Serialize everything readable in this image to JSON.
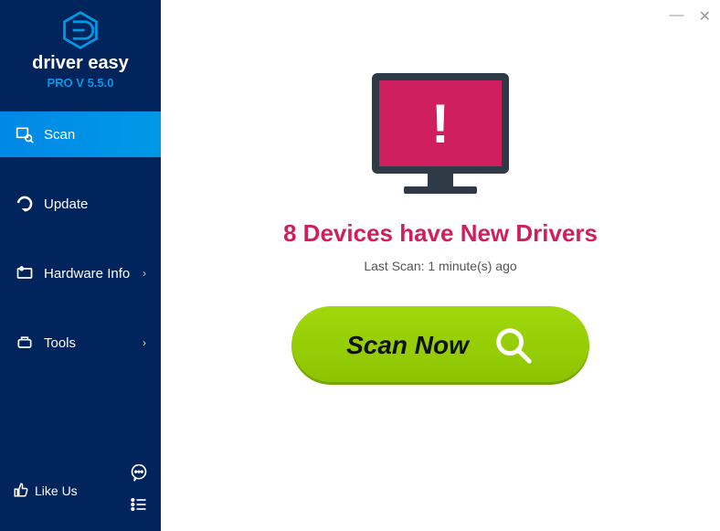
{
  "brand": {
    "name": "driver easy",
    "version_label": "PRO V 5.5.0"
  },
  "sidebar": {
    "items": [
      {
        "label": "Scan",
        "has_chevron": false
      },
      {
        "label": "Update",
        "has_chevron": false
      },
      {
        "label": "Hardware Info",
        "has_chevron": true
      },
      {
        "label": "Tools",
        "has_chevron": true
      }
    ],
    "like_us": "Like Us"
  },
  "main": {
    "headline": "8 Devices have New Drivers",
    "last_scan": "Last Scan: 1 minute(s) ago",
    "scan_button": "Scan Now",
    "alert_mark": "!"
  },
  "titlebar": {
    "minimize": "—",
    "close": "✕"
  }
}
